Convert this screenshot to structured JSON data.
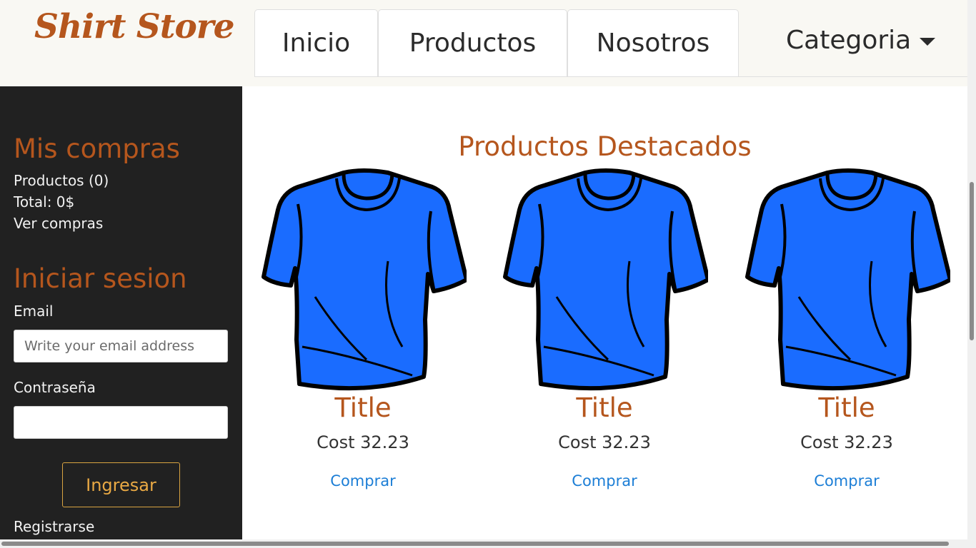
{
  "brand": {
    "name": "Shirt Store"
  },
  "nav": {
    "items": [
      {
        "label": "Inicio"
      },
      {
        "label": "Productos"
      },
      {
        "label": "Nosotros"
      }
    ],
    "dropdown_label": "Categoria"
  },
  "sidebar": {
    "purchases_heading": "Mis compras",
    "products_count": "Productos (0)",
    "total": "Total: 0$",
    "view_purchases": "Ver compras",
    "login_heading": "Iniciar sesion",
    "email_label": "Email",
    "email_placeholder": "Write your email address",
    "email_value": "",
    "password_label": "Contraseña",
    "password_value": "",
    "login_button": "Ingresar",
    "register_link": "Registrarse"
  },
  "featured": {
    "heading": "Productos Destacados",
    "products": [
      {
        "title": "Title",
        "cost": "Cost 32.23",
        "buy": "Comprar",
        "image": "blue-tshirt"
      },
      {
        "title": "Title",
        "cost": "Cost 32.23",
        "buy": "Comprar",
        "image": "blue-tshirt"
      },
      {
        "title": "Title",
        "cost": "Cost 32.23",
        "buy": "Comprar",
        "image": "blue-tshirt"
      }
    ]
  },
  "colors": {
    "accent": "#b5561d",
    "sidebar_bg": "#212121",
    "header_bg": "#f9f8f3",
    "link": "#1c7ed6",
    "button_border": "#d9a441",
    "shirt": "#1a6cff"
  },
  "icons": {
    "dropdown": "caret-down-icon"
  }
}
